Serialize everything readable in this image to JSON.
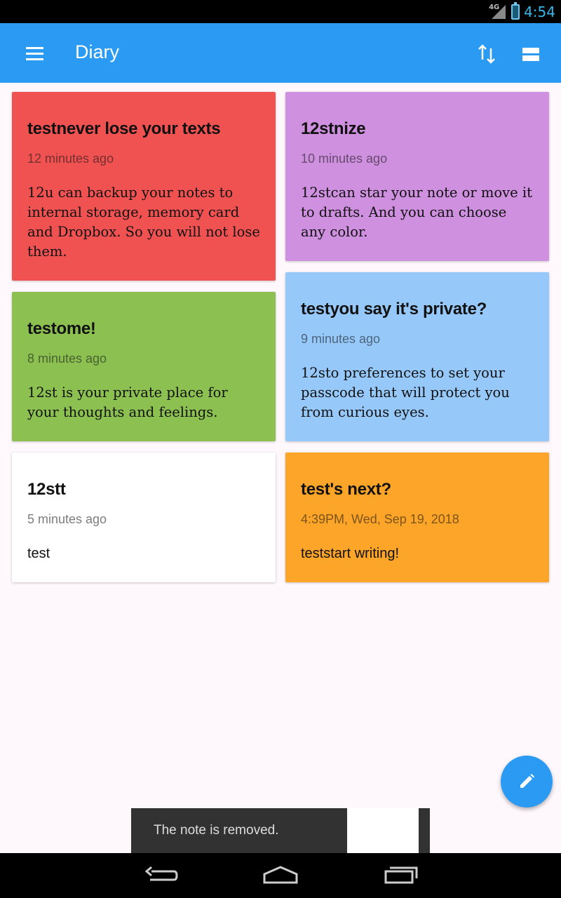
{
  "status_bar": {
    "network": "4G",
    "time": "4:54"
  },
  "app_bar": {
    "title": "Diary"
  },
  "notes": [
    {
      "title": "testnever lose your texts",
      "time": "12 minutes ago",
      "body": "12u can backup your notes to internal storage, memory card and Dropbox. So you will not lose them.",
      "color": "#f05252"
    },
    {
      "title": "12stnize",
      "time": "10 minutes ago",
      "body": "12stcan star your note or move it to drafts. And you can choose any color.",
      "color": "#ce90df"
    },
    {
      "title": "testome!",
      "time": "8 minutes ago",
      "body": "12st is your private place for your thoughts and feelings.",
      "color": "#8cc152"
    },
    {
      "title": "testyou say it's private?",
      "time": "9 minutes ago",
      "body": "12sto preferences to set your passcode that will protect you from curious eyes.",
      "color": "#96c9fa"
    },
    {
      "title": "12stt",
      "time": "5 minutes ago",
      "body": "test",
      "color": "#ffffff"
    },
    {
      "title": "test's next?",
      "time": "4:39PM, Wed, Sep 19, 2018",
      "body": "teststart writing!",
      "color": "#fda528"
    }
  ],
  "snackbar": {
    "message": "The note is removed."
  },
  "colors": {
    "accent": "#2b9af3",
    "background": "#fef8fd"
  },
  "icons": {
    "menu": "menu-icon",
    "sort": "sort-icon",
    "layout": "view-layout-icon",
    "fab": "pencil-icon"
  }
}
